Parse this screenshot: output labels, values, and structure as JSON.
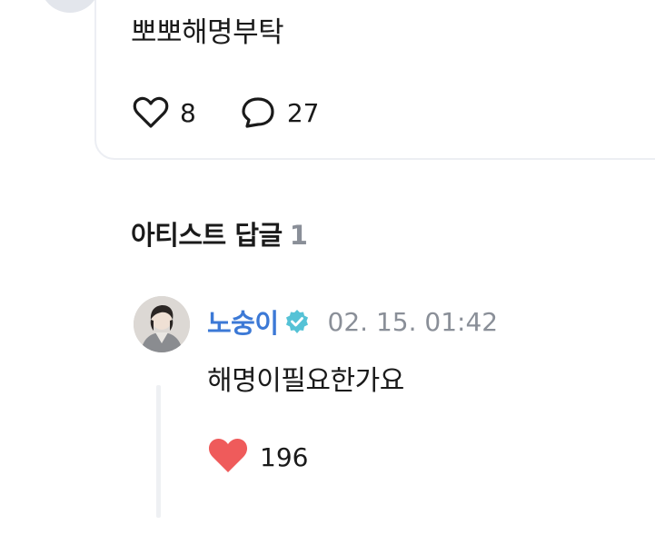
{
  "post": {
    "text": "뽀뽀해명부탁",
    "like_count": "8",
    "comment_count": "27",
    "icons": {
      "like": "heart-outline-icon",
      "comment": "speech-bubble-icon"
    }
  },
  "artist_replies": {
    "title": "아티스트 답글",
    "count": "1",
    "items": [
      {
        "author": "노숭이",
        "verified": true,
        "timestamp": "02. 15. 01:42",
        "text": "해명이필요한가요",
        "like_count": "196",
        "icons": {
          "like": "heart-filled-icon",
          "badge": "verified-badge-icon"
        }
      }
    ]
  },
  "colors": {
    "author_name": "#3c79d6",
    "muted_text": "#8a8f98",
    "heart_filled": "#ef5b5b",
    "verified_badge": "#55c2d6",
    "card_border": "#eceef3"
  }
}
